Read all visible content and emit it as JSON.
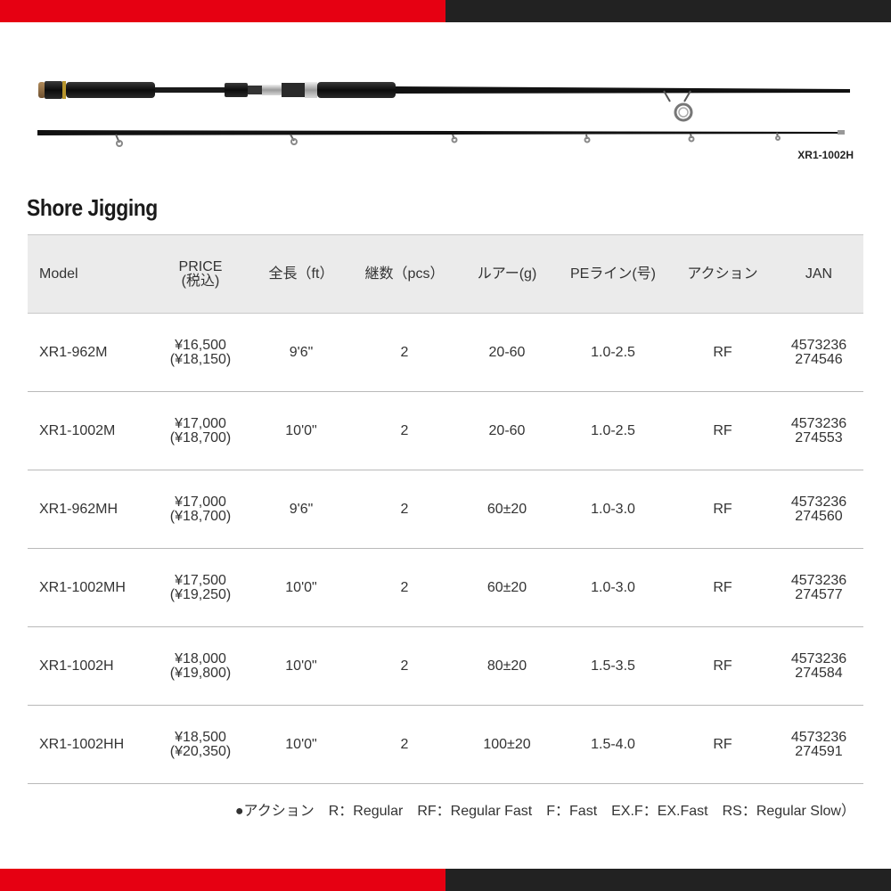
{
  "colors": {
    "accent": "#e60012",
    "dark": "#222222",
    "header_bg": "#ebebeb"
  },
  "rod_image": {
    "model_label": "XR1-1002H"
  },
  "section": {
    "title": "Shore Jigging"
  },
  "table": {
    "headers": {
      "model": "Model",
      "price_line1": "PRICE",
      "price_line2": "(税込)",
      "length": "全長（ft）",
      "pieces": "継数（pcs）",
      "lure": "ルアー(g)",
      "pe_line": "PEライン(号)",
      "action": "アクション",
      "jan": "JAN"
    },
    "rows": [
      {
        "model": "XR1-962M",
        "price": "¥16,500",
        "price_tax": "(¥18,150)",
        "length": "9'6\"",
        "pieces": "2",
        "lure": "20-60",
        "pe_line": "1.0-2.5",
        "action": "RF",
        "jan_1": "4573236",
        "jan_2": "274546"
      },
      {
        "model": "XR1-1002M",
        "price": "¥17,000",
        "price_tax": "(¥18,700)",
        "length": "10'0\"",
        "pieces": "2",
        "lure": "20-60",
        "pe_line": "1.0-2.5",
        "action": "RF",
        "jan_1": "4573236",
        "jan_2": "274553"
      },
      {
        "model": "XR1-962MH",
        "price": "¥17,000",
        "price_tax": "(¥18,700)",
        "length": "9'6\"",
        "pieces": "2",
        "lure": "60±20",
        "pe_line": "1.0-3.0",
        "action": "RF",
        "jan_1": "4573236",
        "jan_2": "274560"
      },
      {
        "model": "XR1-1002MH",
        "price": "¥17,500",
        "price_tax": "(¥19,250)",
        "length": "10'0\"",
        "pieces": "2",
        "lure": "60±20",
        "pe_line": "1.0-3.0",
        "action": "RF",
        "jan_1": "4573236",
        "jan_2": "274577"
      },
      {
        "model": "XR1-1002H",
        "price": "¥18,000",
        "price_tax": "(¥19,800)",
        "length": "10'0\"",
        "pieces": "2",
        "lure": "80±20",
        "pe_line": "1.5-3.5",
        "action": "RF",
        "jan_1": "4573236",
        "jan_2": "274584"
      },
      {
        "model": "XR1-1002HH",
        "price": "¥18,500",
        "price_tax": "(¥20,350)",
        "length": "10'0\"",
        "pieces": "2",
        "lure": "100±20",
        "pe_line": "1.5-4.0",
        "action": "RF",
        "jan_1": "4573236",
        "jan_2": "274591"
      }
    ]
  },
  "legend": {
    "text": "●アクション　R：Regular　RF：Regular Fast　F：Fast　EX.F：EX.Fast　RS：Regular Slow）"
  }
}
